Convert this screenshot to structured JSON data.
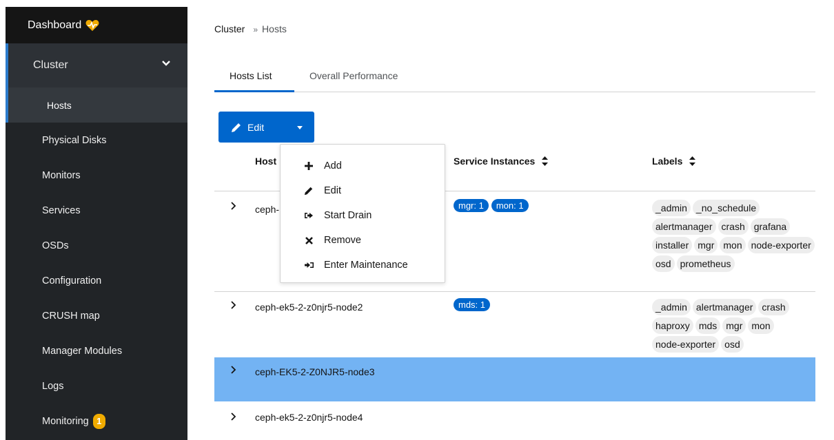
{
  "sidebar": {
    "brand": "Dashboard",
    "group_label": "Cluster",
    "active_sub": "Hosts",
    "items": [
      {
        "label": "Physical Disks"
      },
      {
        "label": "Monitors"
      },
      {
        "label": "Services"
      },
      {
        "label": "OSDs"
      },
      {
        "label": "Configuration"
      },
      {
        "label": "CRUSH map"
      },
      {
        "label": "Manager Modules"
      },
      {
        "label": "Logs"
      },
      {
        "label": "Monitoring"
      }
    ],
    "monitoring_badge": "1",
    "accent": "#0066cc",
    "badge_color": "#f0ab00"
  },
  "breadcrumb": {
    "root": "Cluster",
    "sep": "»",
    "current": "Hosts"
  },
  "tabs": [
    {
      "label": "Hosts List"
    },
    {
      "label": "Overall Performance"
    }
  ],
  "toolbar": {
    "edit_label": "Edit"
  },
  "table": {
    "columns": [
      "Hostname",
      "Service Instances",
      "Labels"
    ],
    "rows": [
      {
        "hostname": "ceph-",
        "services": [
          "mgr: 1",
          "mon: 1"
        ],
        "labels": [
          "_admin",
          "_no_schedule",
          "alertmanager",
          "crash",
          "grafana",
          "installer",
          "mgr",
          "mon",
          "node-exporter",
          "osd",
          "prometheus"
        ]
      },
      {
        "hostname": "ceph-ek5-2-z0njr5-node2",
        "services": [
          "mds: 1"
        ],
        "labels": [
          "_admin",
          "alertmanager",
          "crash",
          "haproxy",
          "mds",
          "mgr",
          "mon",
          "node-exporter",
          "osd"
        ]
      },
      {
        "hostname": "ceph-EK5-2-Z0NJR5-node3",
        "services": [],
        "labels": []
      },
      {
        "hostname": "ceph-ek5-2-z0njr5-node4",
        "services": [],
        "labels": []
      }
    ],
    "host_header_visible": "Host"
  },
  "menu": {
    "items": [
      {
        "label": "Add",
        "icon": "plus-icon"
      },
      {
        "label": "Edit",
        "icon": "pencil-icon"
      },
      {
        "label": "Start Drain",
        "icon": "sign-out-icon"
      },
      {
        "label": "Remove",
        "icon": "times-icon"
      },
      {
        "label": "Enter Maintenance",
        "icon": "sign-in-icon"
      }
    ]
  }
}
